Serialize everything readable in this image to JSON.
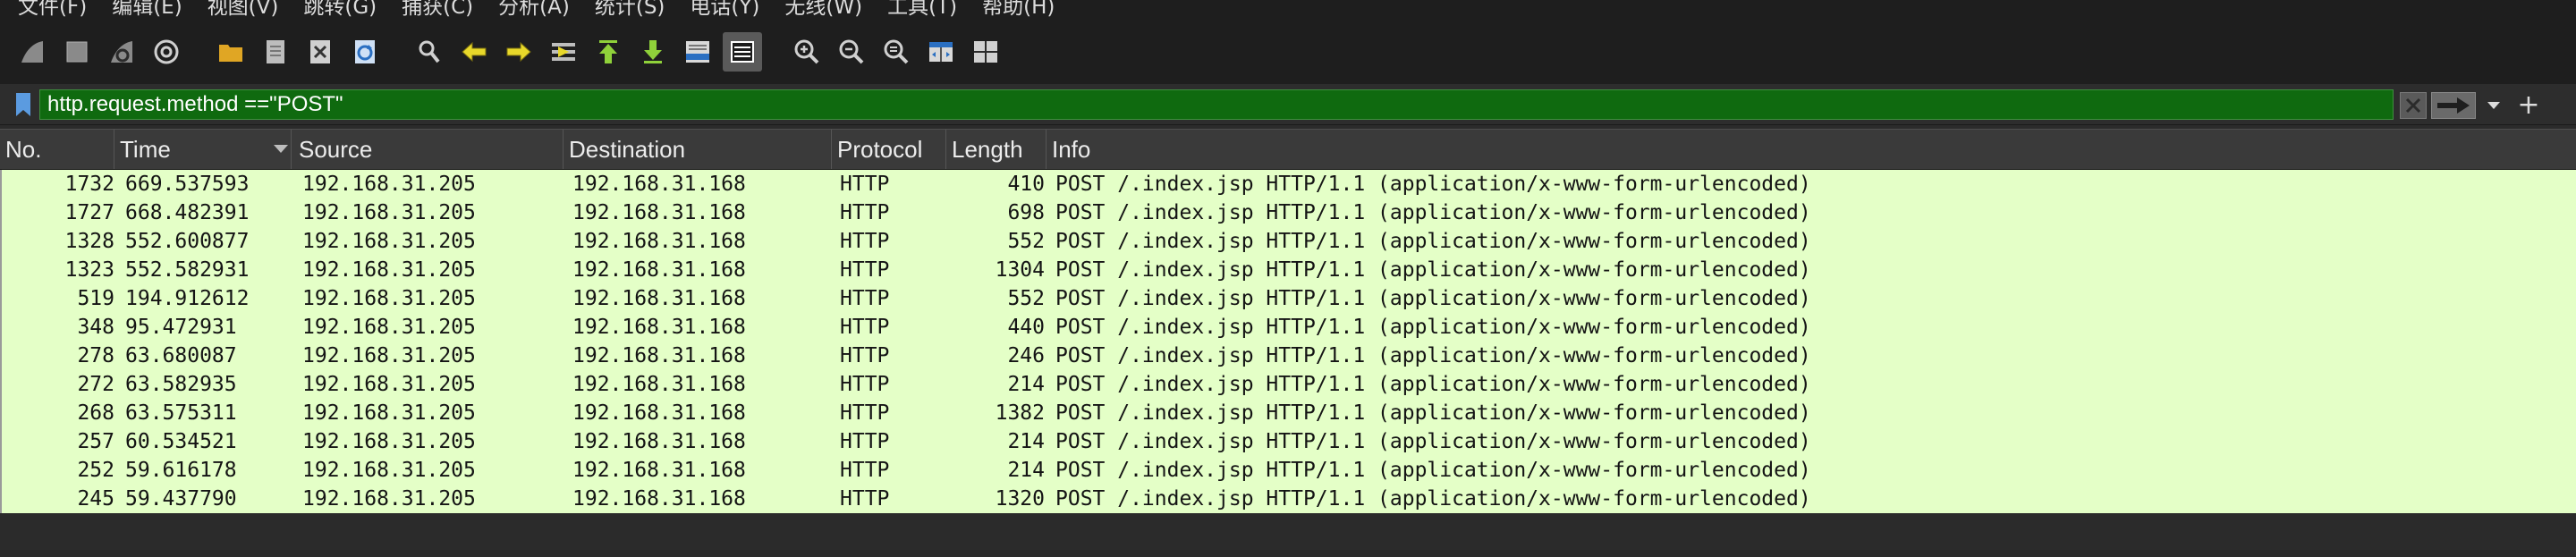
{
  "menubar": {
    "items": [
      "文件(F)",
      "编辑(E)",
      "视图(V)",
      "跳转(G)",
      "捕获(C)",
      "分析(A)",
      "统计(S)",
      "电话(Y)",
      "无线(W)",
      "工具(T)",
      "帮助(H)"
    ]
  },
  "toolbar": {
    "buttons": [
      {
        "name": "start-capture-fin-icon",
        "color": "#8a8a8a"
      },
      {
        "name": "stop-capture-icon",
        "color": "#8a8a8a"
      },
      {
        "name": "restart-capture-icon",
        "color": "#8a8a8a"
      },
      {
        "name": "capture-options-gear-icon",
        "color": "#d0d0d0"
      },
      {
        "name": "open-file-folder-icon",
        "color": "#e0a624"
      },
      {
        "name": "save-file-icon",
        "color": "#bdbdbd"
      },
      {
        "name": "close-file-icon",
        "color": "#d0d0d0"
      },
      {
        "name": "reload-file-icon",
        "color": "#4a90d9"
      },
      {
        "name": "find-packet-magnifier-icon",
        "color": "#d0d0d0"
      },
      {
        "name": "go-back-arrow-icon",
        "color": "#e8d82a"
      },
      {
        "name": "go-forward-arrow-icon",
        "color": "#e8d82a"
      },
      {
        "name": "go-to-packet-icon",
        "color": "#e8d82a"
      },
      {
        "name": "go-to-first-packet-icon",
        "color": "#8fd13a"
      },
      {
        "name": "go-to-last-packet-icon",
        "color": "#8fd13a"
      },
      {
        "name": "auto-scroll-icon",
        "color": "#4a90d9"
      },
      {
        "name": "colorize-list-icon",
        "color": "#ffffff"
      },
      {
        "name": "zoom-in-icon",
        "color": "#d0d0d0"
      },
      {
        "name": "zoom-out-icon",
        "color": "#d0d0d0"
      },
      {
        "name": "zoom-normal-icon",
        "color": "#d0d0d0"
      },
      {
        "name": "resize-columns-icon",
        "color": "#4a90d9"
      },
      {
        "name": "layout-panes-icon",
        "color": "#d0d0d0"
      }
    ]
  },
  "filter": {
    "value": "http.request.method ==\"POST\"",
    "field_color": "#0f6a0f"
  },
  "columns": {
    "no": "No.",
    "time": "Time",
    "source": "Source",
    "destination": "Destination",
    "protocol": "Protocol",
    "length": "Length",
    "info": "Info"
  },
  "row_color": "#e4ffc7",
  "packets": [
    {
      "no": "1732",
      "time": "669.537593",
      "source": "192.168.31.205",
      "destination": "192.168.31.168",
      "protocol": "HTTP",
      "length": "410",
      "info": "POST /.index.jsp HTTP/1.1  (application/x-www-form-urlencoded)"
    },
    {
      "no": "1727",
      "time": "668.482391",
      "source": "192.168.31.205",
      "destination": "192.168.31.168",
      "protocol": "HTTP",
      "length": "698",
      "info": "POST /.index.jsp HTTP/1.1  (application/x-www-form-urlencoded)"
    },
    {
      "no": "1328",
      "time": "552.600877",
      "source": "192.168.31.205",
      "destination": "192.168.31.168",
      "protocol": "HTTP",
      "length": "552",
      "info": "POST /.index.jsp HTTP/1.1  (application/x-www-form-urlencoded)"
    },
    {
      "no": "1323",
      "time": "552.582931",
      "source": "192.168.31.205",
      "destination": "192.168.31.168",
      "protocol": "HTTP",
      "length": "1304",
      "info": "POST /.index.jsp HTTP/1.1  (application/x-www-form-urlencoded)"
    },
    {
      "no": "519",
      "time": "194.912612",
      "source": "192.168.31.205",
      "destination": "192.168.31.168",
      "protocol": "HTTP",
      "length": "552",
      "info": "POST /.index.jsp HTTP/1.1  (application/x-www-form-urlencoded)"
    },
    {
      "no": "348",
      "time": "95.472931",
      "source": "192.168.31.205",
      "destination": "192.168.31.168",
      "protocol": "HTTP",
      "length": "440",
      "info": "POST /.index.jsp HTTP/1.1  (application/x-www-form-urlencoded)"
    },
    {
      "no": "278",
      "time": "63.680087",
      "source": "192.168.31.205",
      "destination": "192.168.31.168",
      "protocol": "HTTP",
      "length": "246",
      "info": "POST /.index.jsp HTTP/1.1  (application/x-www-form-urlencoded)"
    },
    {
      "no": "272",
      "time": "63.582935",
      "source": "192.168.31.205",
      "destination": "192.168.31.168",
      "protocol": "HTTP",
      "length": "214",
      "info": "POST /.index.jsp HTTP/1.1  (application/x-www-form-urlencoded)"
    },
    {
      "no": "268",
      "time": "63.575311",
      "source": "192.168.31.205",
      "destination": "192.168.31.168",
      "protocol": "HTTP",
      "length": "1382",
      "info": "POST /.index.jsp HTTP/1.1  (application/x-www-form-urlencoded)"
    },
    {
      "no": "257",
      "time": "60.534521",
      "source": "192.168.31.205",
      "destination": "192.168.31.168",
      "protocol": "HTTP",
      "length": "214",
      "info": "POST /.index.jsp HTTP/1.1  (application/x-www-form-urlencoded)"
    },
    {
      "no": "252",
      "time": "59.616178",
      "source": "192.168.31.205",
      "destination": "192.168.31.168",
      "protocol": "HTTP",
      "length": "214",
      "info": "POST /.index.jsp HTTP/1.1  (application/x-www-form-urlencoded)"
    },
    {
      "no": "245",
      "time": "59.437790",
      "source": "192.168.31.205",
      "destination": "192.168.31.168",
      "protocol": "HTTP",
      "length": "1320",
      "info": "POST /.index.jsp HTTP/1.1  (application/x-www-form-urlencoded)"
    }
  ]
}
